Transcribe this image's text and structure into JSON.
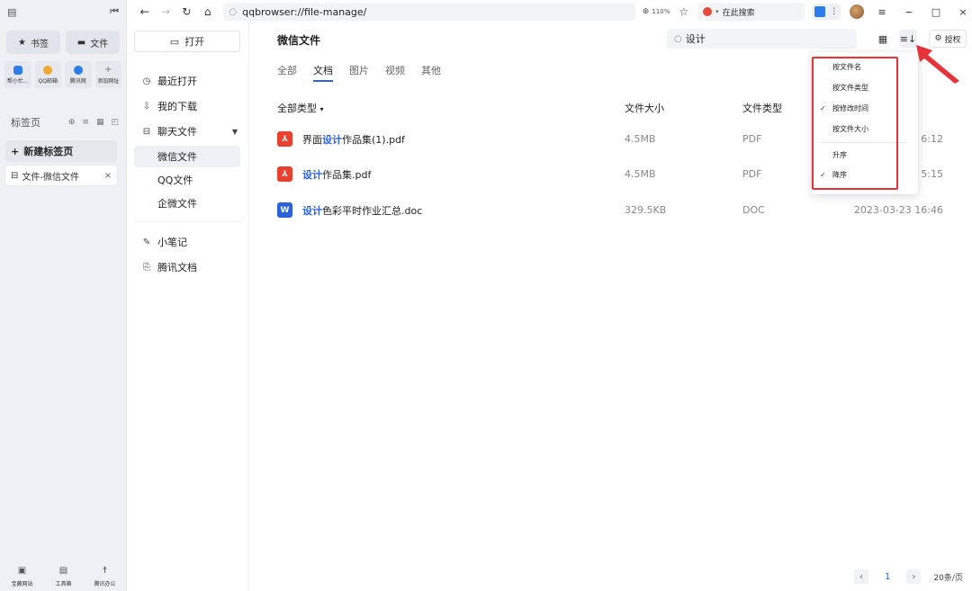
{
  "browser": {
    "url": "qqbrowser://file-manage/",
    "zoom": "110%",
    "search_placeholder": "在此搜索"
  },
  "sidebar": {
    "pills": [
      {
        "label": "书签",
        "icon": "star-icon"
      },
      {
        "label": "文件",
        "icon": "folder-icon"
      }
    ],
    "quick": [
      {
        "label": "帮小忙...",
        "color": "#2b7de9"
      },
      {
        "label": "QQ邮箱",
        "color": "#f0a830"
      },
      {
        "label": "腾讯网",
        "color": "#2b7de9"
      },
      {
        "label": "添加网址",
        "color": "#999999"
      }
    ],
    "tabs_title": "标签页",
    "new_tab": "新建标签页",
    "open_tab": "文件-微信文件",
    "bottom": [
      "宝藏网站",
      "工具箱",
      "腾讯办公"
    ]
  },
  "fnav": {
    "open": "打开",
    "items": {
      "recent": "最近打开",
      "downloads": "我的下载",
      "chat": "聊天文件",
      "wechat": "微信文件",
      "qq": "QQ文件",
      "wecom": "企微文件",
      "notes": "小笔记",
      "tdocs": "腾讯文档"
    }
  },
  "main": {
    "title": "微信文件",
    "search_value": "设计",
    "auth": "授权",
    "tabs": [
      "全部",
      "文档",
      "图片",
      "视频",
      "其他"
    ],
    "active_tab": "文档",
    "columns": {
      "name": "全部类型",
      "size": "文件大小",
      "type": "文件类型"
    },
    "files": [
      {
        "pre": "界面",
        "hl": "设计",
        "post": "作品集(1).pdf",
        "size": "4.5MB",
        "type": "PDF",
        "date": "6:12",
        "kind": "pdf"
      },
      {
        "pre": "",
        "hl": "设计",
        "post": "作品集.pdf",
        "size": "4.5MB",
        "type": "PDF",
        "date": "5:15",
        "kind": "pdf"
      },
      {
        "pre": "",
        "hl": "设计",
        "post": "色彩平时作业汇总.doc",
        "size": "329.5KB",
        "type": "DOC",
        "date": "2023-03-23 16:46",
        "kind": "doc"
      }
    ]
  },
  "sort_menu": {
    "items": [
      "按文件名",
      "按文件类型",
      "按修改时间",
      "按文件大小"
    ],
    "order": [
      "升序",
      "降序"
    ],
    "checked_sort": "按修改时间",
    "checked_order": "降序"
  },
  "pager": {
    "current": "1",
    "size": "20条/页"
  },
  "colors": {
    "accent": "#2e63e8",
    "highlight_box": "#e8323a",
    "arrow": "#e8323a"
  }
}
